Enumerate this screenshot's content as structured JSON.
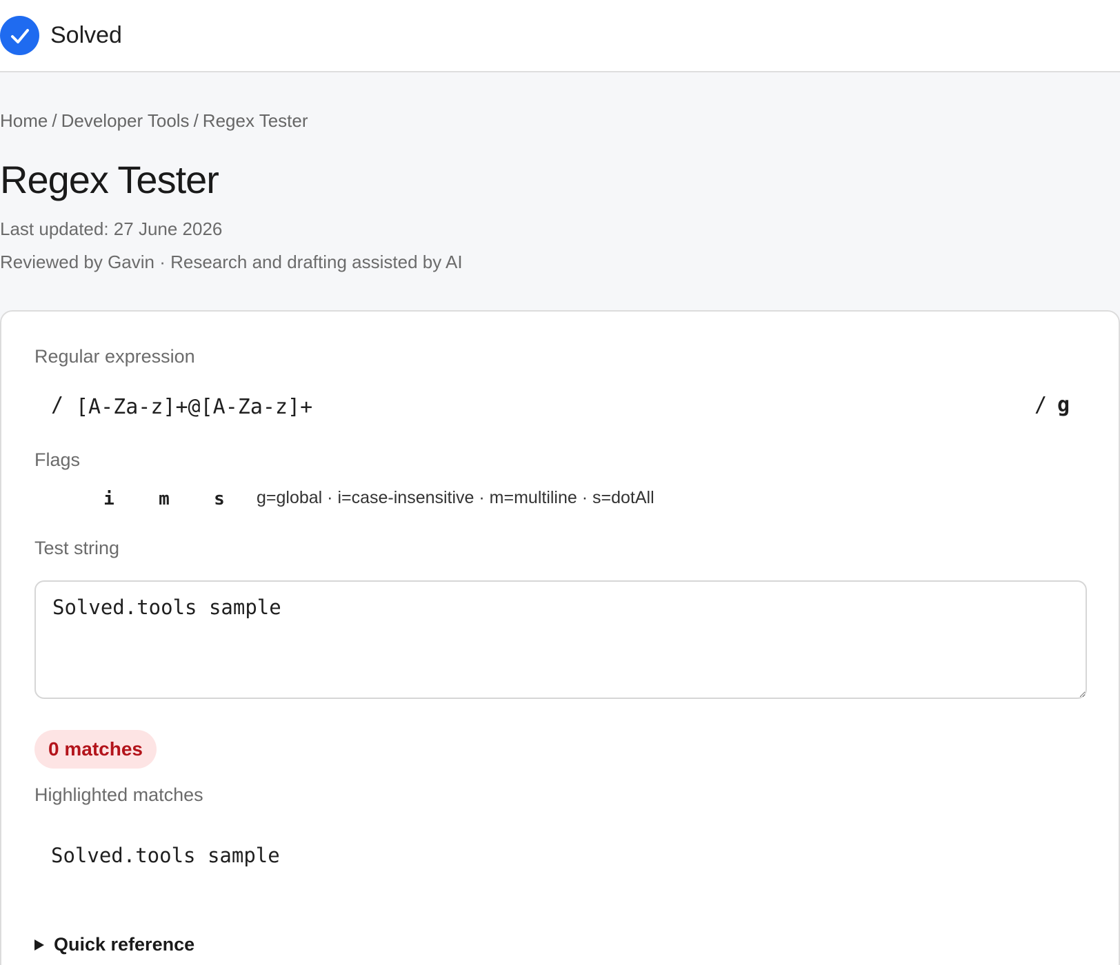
{
  "header": {
    "brand_name": "Solved",
    "logo_icon": "check-circle-icon",
    "accent_color": "#1f6bf0"
  },
  "breadcrumb": {
    "items": [
      "Home",
      "Developer Tools",
      "Regex Tester"
    ],
    "separator": "/"
  },
  "page": {
    "title": "Regex Tester",
    "last_updated": "Last updated: 27 June 2026",
    "reviewed_by": "Reviewed by Gavin · Research and drafting assisted by AI"
  },
  "regex": {
    "label": "Regular expression",
    "slash": "/",
    "pattern": "[A-Za-z]+@[A-Za-z]+",
    "active_flags": "g"
  },
  "flags": {
    "label": "Flags",
    "toggles": [
      "i",
      "m",
      "s"
    ],
    "legend": "g=global · i=case-insensitive · m=multiline · s=dotAll"
  },
  "test": {
    "label": "Test string",
    "value": "Solved.tools sample"
  },
  "result": {
    "match_count": "0 matches",
    "badge_bg": "#fde4e4",
    "badge_text_color": "#b3141b"
  },
  "highlighted": {
    "label": "Highlighted matches",
    "text": "Solved.tools sample"
  },
  "quick_reference": {
    "label": "Quick reference",
    "icon": "disclosure-triangle-icon"
  }
}
